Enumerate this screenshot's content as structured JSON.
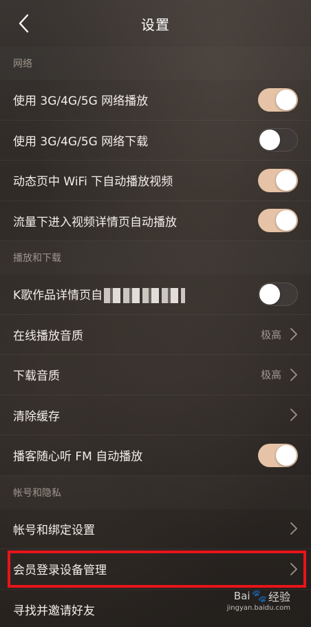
{
  "header": {
    "title": "设置"
  },
  "sections": {
    "network": {
      "title": "网络",
      "items": [
        {
          "label": "使用 3G/4G/5G 网络播放",
          "toggle": true
        },
        {
          "label": "使用 3G/4G/5G 网络下载",
          "toggle": false
        },
        {
          "label": "动态页中 WiFi 下自动播放视频",
          "toggle": true
        },
        {
          "label": "流量下进入视频详情页自动播放",
          "toggle": true
        }
      ]
    },
    "playback": {
      "title": "播放和下载",
      "items": [
        {
          "label": "K歌作品详情页自",
          "toggle": false
        },
        {
          "label": "在线播放音质",
          "value": "极高"
        },
        {
          "label": "下载音质",
          "value": "极高"
        },
        {
          "label": "清除缓存"
        },
        {
          "label": "播客随心听 FM 自动播放",
          "toggle": true
        }
      ]
    },
    "account": {
      "title": "帐号和隐私",
      "items": [
        {
          "label": "帐号和绑定设置"
        },
        {
          "label": "会员登录设备管理"
        },
        {
          "label": "寻找并邀请好友"
        }
      ]
    }
  },
  "watermark": {
    "brand": "经验",
    "url": "jingyan.baidu.com"
  },
  "colors": {
    "toggle_on": "#e6c3a6",
    "highlight": "#e8141a"
  }
}
